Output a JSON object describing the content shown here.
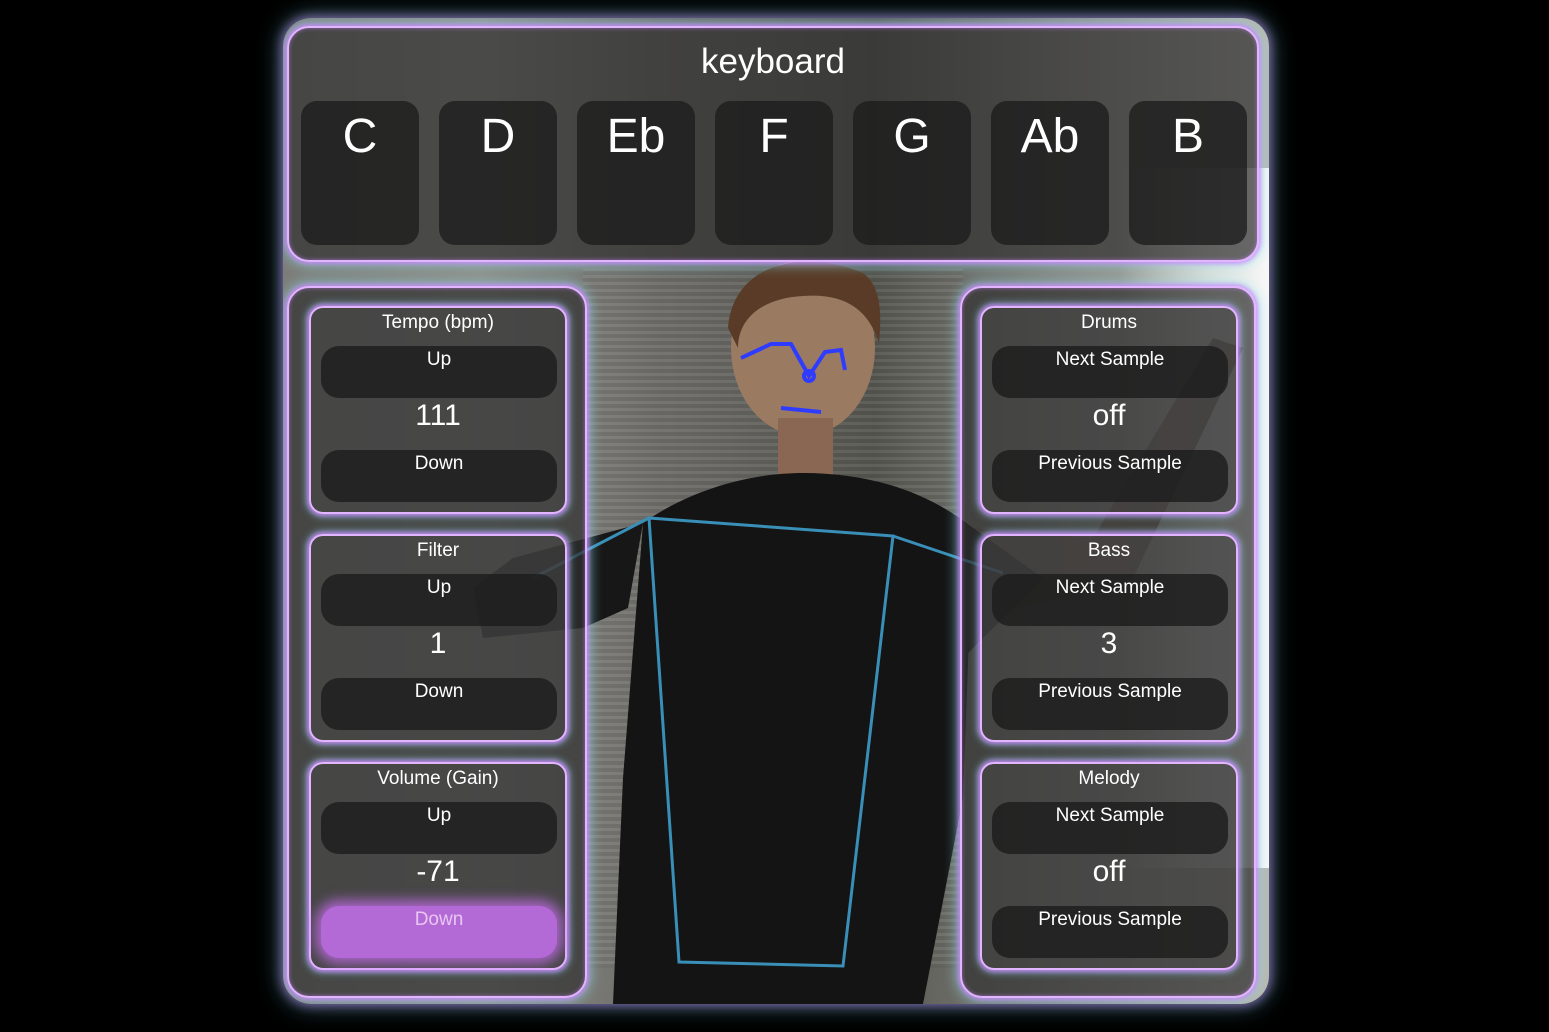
{
  "keyboard": {
    "title": "keyboard",
    "keys": [
      "C",
      "D",
      "Eb",
      "F",
      "G",
      "Ab",
      "B"
    ]
  },
  "left_controls": [
    {
      "title": "Tempo (bpm)",
      "up_label": "Up",
      "value": "111",
      "down_label": "Down"
    },
    {
      "title": "Filter",
      "up_label": "Up",
      "value": "1",
      "down_label": "Down"
    },
    {
      "title": "Volume (Gain)",
      "up_label": "Up",
      "value": "-71",
      "down_label": "Down"
    }
  ],
  "right_controls": [
    {
      "title": "Drums",
      "next_label": "Next Sample",
      "value": "off",
      "prev_label": "Previous Sample"
    },
    {
      "title": "Bass",
      "next_label": "Next Sample",
      "value": "3",
      "prev_label": "Previous Sample"
    },
    {
      "title": "Melody",
      "next_label": "Next Sample",
      "value": "off",
      "prev_label": "Previous Sample"
    }
  ],
  "colors": {
    "panel_glow_purple": "#e3b4ff",
    "panel_glow_cyan": "#8ce6f0",
    "active_button": "#b46ad6",
    "skeleton_face": "#2f3cff",
    "skeleton_body": "#3a8fb8"
  }
}
